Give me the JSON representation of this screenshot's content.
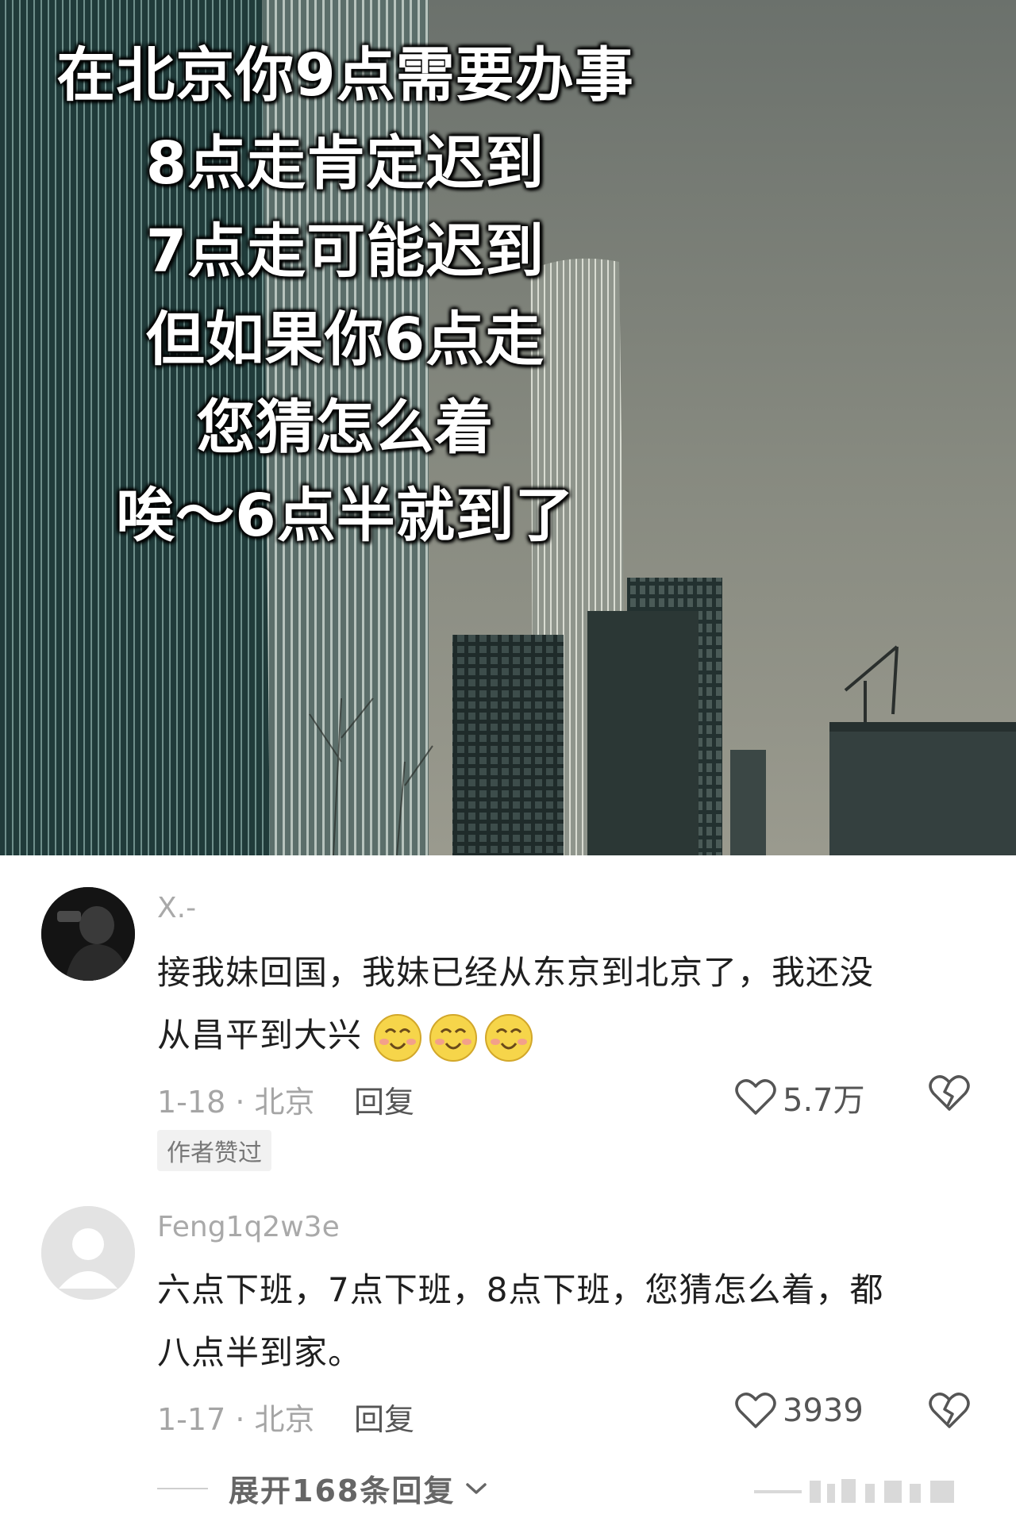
{
  "hero": {
    "caption_lines": [
      "在北京你9点需要办事",
      "8点走肯定迟到",
      "7点走可能迟到",
      "但如果你6点走",
      "您猜怎么着",
      "唉～6点半就到了"
    ]
  },
  "comments": [
    {
      "username": "X.-",
      "text_line1": "接我妹回国，我妹已经从东京到北京了，我还没",
      "text_line2": "从昌平到大兴",
      "emoji_count": 3,
      "emoji_icon": "smile-emoji-icon",
      "meta": "1-18 · 北京",
      "reply_label": "回复",
      "likes": "5.7万",
      "badge": "作者赞过"
    },
    {
      "username": "Feng1q2w3e",
      "text_line1": "六点下班，7点下班，8点下班，您猜怎么着，都",
      "text_line2": "八点半到家。",
      "meta": "1-17 · 北京",
      "reply_label": "回复",
      "likes": "3939"
    }
  ],
  "expand_replies": "展开168条回复",
  "colors": {
    "username": "#a9a9a9",
    "text": "#1f1f1f",
    "meta": "#a5a5a5"
  }
}
